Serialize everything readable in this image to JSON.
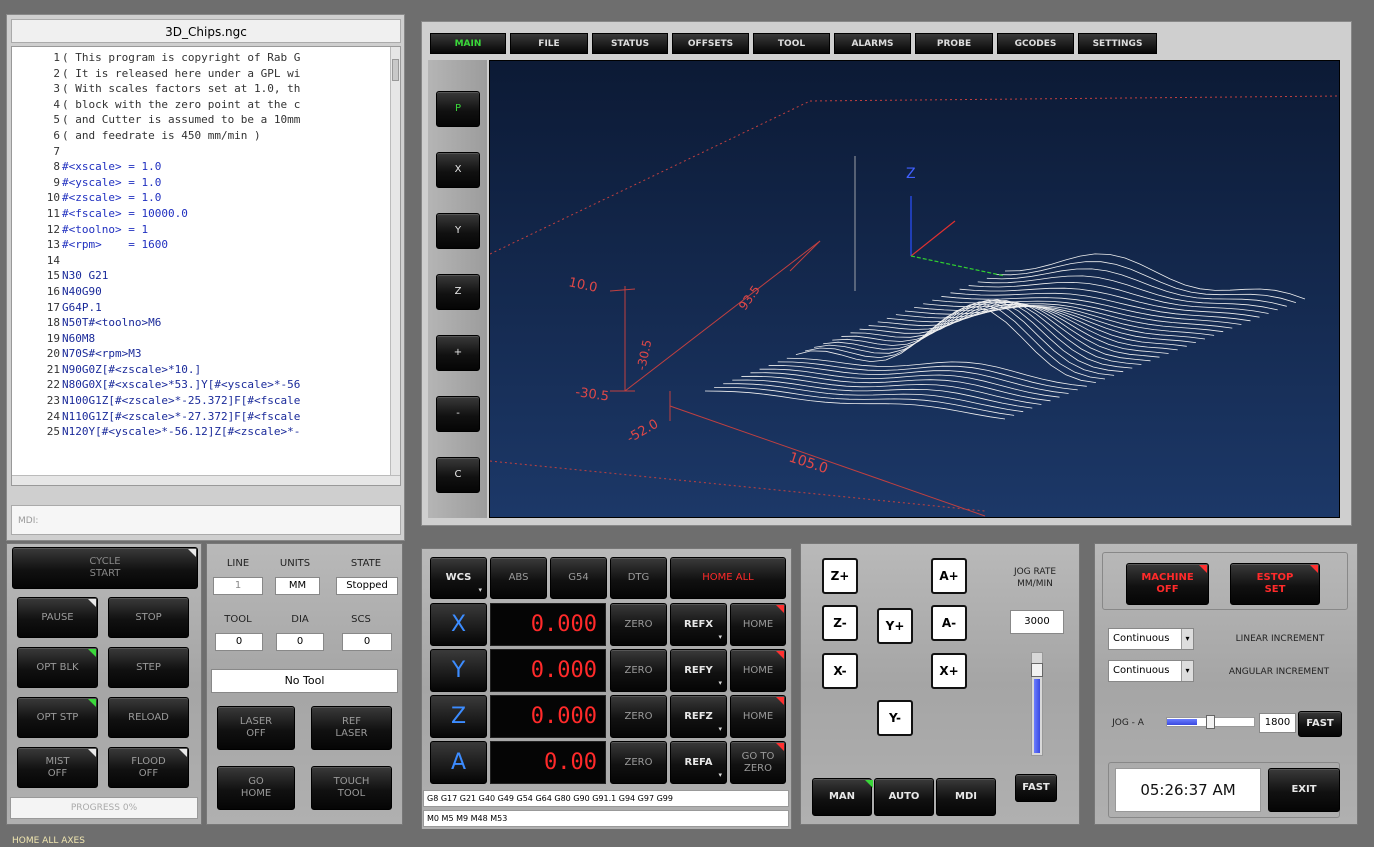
{
  "editor": {
    "title": "3D_Chips.ngc",
    "lines": [
      {
        "n": "1",
        "t": "( This program is copyright of Rab G"
      },
      {
        "n": "2",
        "t": "( It is released here under a GPL wi"
      },
      {
        "n": "3",
        "t": "( With scales factors set at 1.0, th"
      },
      {
        "n": "4",
        "t": "( block with the zero point at the c"
      },
      {
        "n": "5",
        "t": "( and Cutter is assumed to be a 10mm"
      },
      {
        "n": "6",
        "t": "( and feedrate is 450 mm/min )"
      },
      {
        "n": "7",
        "t": ""
      },
      {
        "n": "8",
        "t": "#<xscale> = 1.0"
      },
      {
        "n": "9",
        "t": "#<yscale> = 1.0"
      },
      {
        "n": "10",
        "t": "#<zscale> = 1.0"
      },
      {
        "n": "11",
        "t": "#<fscale> = 10000.0"
      },
      {
        "n": "12",
        "t": "#<toolno> = 1"
      },
      {
        "n": "13",
        "t": "#<rpm>    = 1600"
      },
      {
        "n": "14",
        "t": ""
      },
      {
        "n": "15",
        "t": "N30 G21"
      },
      {
        "n": "16",
        "t": "N40G90"
      },
      {
        "n": "17",
        "t": "G64P.1"
      },
      {
        "n": "18",
        "t": "N50T#<toolno>M6"
      },
      {
        "n": "19",
        "t": "N60M8"
      },
      {
        "n": "20",
        "t": "N70S#<rpm>M3"
      },
      {
        "n": "21",
        "t": "N90G0Z[#<zscale>*10.]"
      },
      {
        "n": "22",
        "t": "N80G0X[#<xscale>*53.]Y[#<yscale>*-56"
      },
      {
        "n": "23",
        "t": "N100G1Z[#<zscale>*-25.372]F[#<fscale"
      },
      {
        "n": "24",
        "t": "N110G1Z[#<zscale>*-27.372]F[#<fscale"
      },
      {
        "n": "25",
        "t": "N120Y[#<yscale>*-56.12]Z[#<zscale>*-"
      }
    ],
    "mdi_label": "MDI:"
  },
  "tabs": [
    "MAIN",
    "FILE",
    "STATUS",
    "OFFSETS",
    "TOOL",
    "ALARMS",
    "PROBE",
    "GCODES",
    "SETTINGS"
  ],
  "view_buttons": [
    "P",
    "X",
    "Y",
    "Z",
    "+",
    "-",
    "C"
  ],
  "preview": {
    "axis_z": "Z",
    "dims": [
      "10.0",
      "-30.5",
      "-52.0",
      "105.0",
      "-30.5",
      "93.5"
    ]
  },
  "controls": {
    "cycle_start": "CYCLE\nSTART",
    "pause": "PAUSE",
    "stop": "STOP",
    "opt_blk": "OPT BLK",
    "step": "STEP",
    "opt_stp": "OPT STP",
    "reload": "RELOAD",
    "mist": "MIST\nOFF",
    "flood": "FLOOD\nOFF",
    "progress": "PROGRESS 0%"
  },
  "status": {
    "line_label": "LINE",
    "units_label": "UNITS",
    "state_label": "STATE",
    "line": "1",
    "units": "MM",
    "state": "Stopped",
    "tool_label": "TOOL",
    "dia_label": "DIA",
    "scs_label": "SCS",
    "tool": "0",
    "dia": "0",
    "scs": "0",
    "tool_desc": "No Tool",
    "laser": "LASER\nOFF",
    "ref_laser": "REF\nLASER",
    "go_home": "GO\nHOME",
    "touch_tool": "TOUCH\nTOOL"
  },
  "dro": {
    "wcs": "WCS",
    "abs": "ABS",
    "g54": "G54",
    "dtg": "DTG",
    "home_all": "HOME ALL",
    "axes": [
      {
        "axis": "X",
        "value": "0.000",
        "zero": "ZERO",
        "ref": "REFX",
        "home": "HOME"
      },
      {
        "axis": "Y",
        "value": "0.000",
        "zero": "ZERO",
        "ref": "REFY",
        "home": "HOME"
      },
      {
        "axis": "Z",
        "value": "0.000",
        "zero": "ZERO",
        "ref": "REFZ",
        "home": "HOME"
      },
      {
        "axis": "A",
        "value": "0.00",
        "zero": "ZERO",
        "ref": "REFA",
        "home": "GO TO\nZERO"
      }
    ],
    "gcodes": "G8 G17 G21 G40 G49 G54 G64 G80 G90 G91.1 G94 G97 G99",
    "mcodes": "M0 M5 M9 M48 M53"
  },
  "jog": {
    "z_plus": "Z+",
    "z_minus": "Z-",
    "a_plus": "A+",
    "a_minus": "A-",
    "y_plus": "Y+",
    "y_minus": "Y-",
    "x_minus": "X-",
    "x_plus": "X+",
    "rate_label": "JOG RATE\nMM/MIN",
    "rate": "3000",
    "fast": "FAST",
    "man": "MAN",
    "auto": "AUTO",
    "mdi": "MDI"
  },
  "machine": {
    "machine_off": "MACHINE\nOFF",
    "estop_set": "ESTOP\nSET",
    "linear_sel": "Continuous",
    "linear_label": "LINEAR INCREMENT",
    "angular_sel": "Continuous",
    "angular_label": "ANGULAR INCREMENT",
    "jog_a_label": "JOG - A",
    "jog_a_value": "1800",
    "jog_a_level_pct": 35,
    "fast": "FAST",
    "clock": "05:26:37 AM",
    "exit": "EXIT"
  },
  "statusbar": "HOME ALL AXES",
  "colors": {
    "dro_red": "#ff2a2a",
    "axis_blue": "#3c8cff",
    "preview_bg": "#102040"
  }
}
